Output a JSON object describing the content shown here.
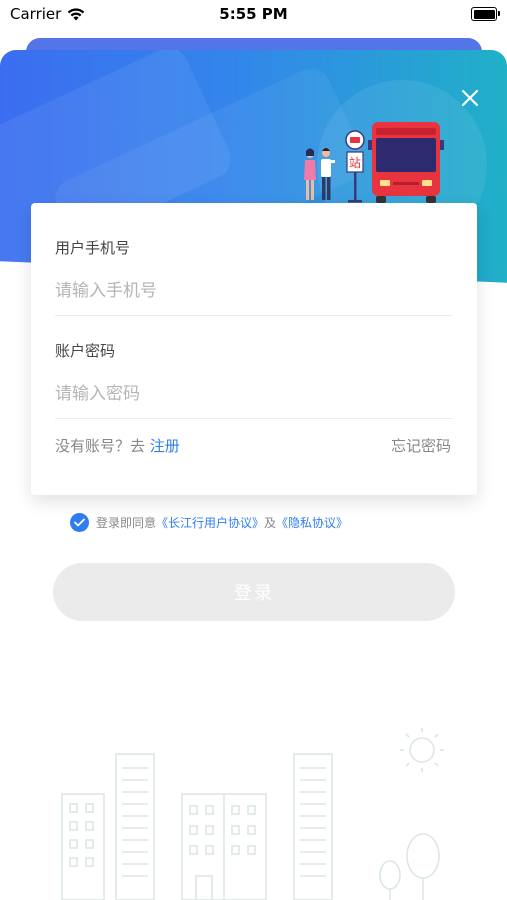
{
  "status_bar": {
    "carrier": "Carrier",
    "time": "5:55 PM"
  },
  "illustration": {
    "stop_sign": "站"
  },
  "form": {
    "phone_label": "用户手机号",
    "phone_placeholder": "请输入手机号",
    "password_label": "账户密码",
    "password_placeholder": "请输入密码",
    "no_account_text": "没有账号？去",
    "register_label": "注册",
    "forgot_label": "忘记密码"
  },
  "agreement": {
    "prefix": "登录即同意",
    "user_agreement": "《长江行用户协议》",
    "conjunction": "及",
    "privacy_policy": "《隐私协议》",
    "checked": true
  },
  "login_button": {
    "label": "登录",
    "enabled": false
  },
  "colors": {
    "accent": "#2f7df0",
    "banner_start": "#3b6df0",
    "banner_end": "#20b0c8",
    "bus": "#e8343f",
    "disabled_button": "#ebebeb"
  }
}
